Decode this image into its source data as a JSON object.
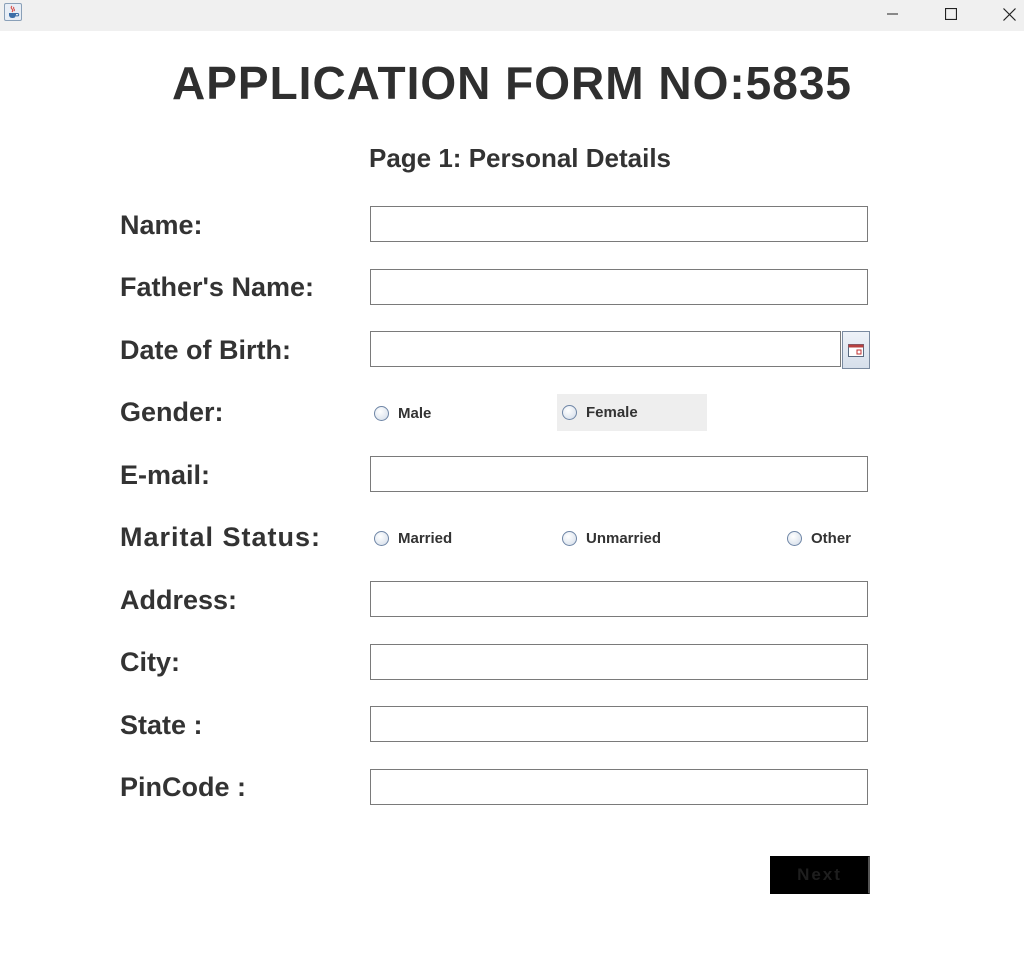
{
  "window": {
    "app_icon": "java-cup-icon",
    "controls": [
      "minimize-icon",
      "maximize-icon",
      "close-icon"
    ]
  },
  "form": {
    "title": "APPLICATION FORM NO:5835",
    "subtitle": "Page 1: Personal Details"
  },
  "labels": {
    "name": "Name:",
    "father_name": "Father's Name:",
    "dob": "Date of Birth:",
    "gender": "Gender:",
    "email": "E-mail:",
    "marital_status": "Marital Status:",
    "address": "Address:",
    "city": "City:",
    "state": "State :",
    "pincode": "PinCode :"
  },
  "fields": {
    "name": "",
    "father_name": "",
    "dob": "",
    "email": "",
    "address": "",
    "city": "",
    "state": "",
    "pincode": ""
  },
  "gender_options": {
    "male": "Male",
    "female": "Female"
  },
  "marital_options": {
    "married": "Married",
    "unmarried": "Unmarried",
    "other": "Other"
  },
  "calendar_button_icon": "calendar-icon",
  "buttons": {
    "next": "Next"
  },
  "colors": {
    "next_button_bg": "#000000",
    "focus_highlight": "#eeeeee",
    "text": "#333333"
  }
}
